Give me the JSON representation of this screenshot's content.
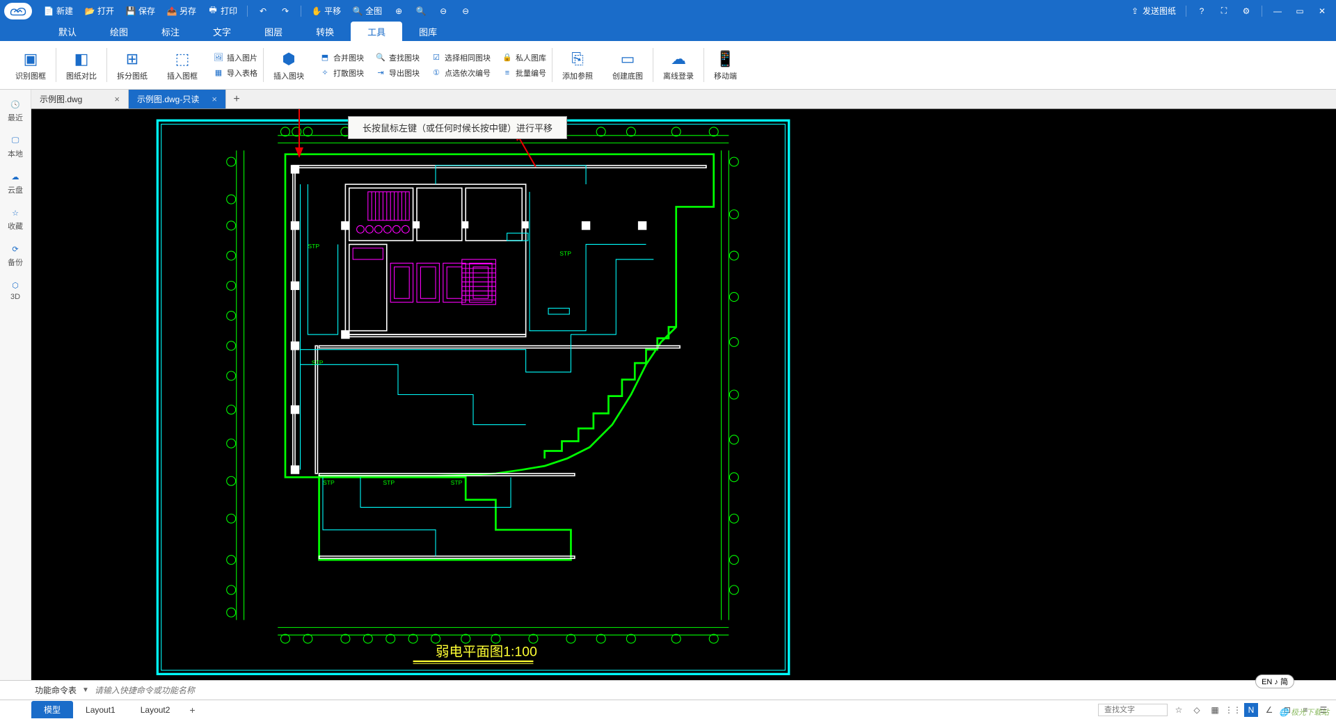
{
  "titlebar": {
    "new": "新建",
    "open": "打开",
    "save": "保存",
    "saveas": "另存",
    "print": "打印",
    "pan": "平移",
    "full": "全图",
    "send": "发送图纸"
  },
  "menu": {
    "default": "默认",
    "draw": "绘图",
    "annotate": "标注",
    "text": "文字",
    "layer": "图层",
    "convert": "转换",
    "tools": "工具",
    "library": "图库"
  },
  "ribbon": {
    "recognize_frame": "识别图框",
    "compare": "图纸对比",
    "split": "拆分图纸",
    "insert_frame": "插入图框",
    "insert_image": "插入图片",
    "import_table": "导入表格",
    "insert_block": "插入图块",
    "merge_block": "合并图块",
    "explode_block": "打散图块",
    "find_block": "查找图块",
    "export_block": "导出图块",
    "select_same": "选择相同图块",
    "click_number": "点选依次编号",
    "private_lib": "私人图库",
    "batch_number": "批量编号",
    "add_ref": "添加参照",
    "create_base": "创建底图",
    "offline_login": "离线登录",
    "mobile": "移动端"
  },
  "sidebar": {
    "recent": "最近",
    "local": "本地",
    "cloud": "云盘",
    "favorite": "收藏",
    "backup": "备份",
    "three_d": "3D"
  },
  "tabs": {
    "tab1": "示例图.dwg",
    "tab2": "示例图.dwg-只读"
  },
  "tooltip": "长按鼠标左键（或任何时候长按中键）进行平移",
  "drawing": {
    "title": "弱电平面图",
    "scale": "1:100"
  },
  "cmdbar": {
    "label": "功能命令表",
    "placeholder": "请输入快捷命令或功能名称"
  },
  "statusbar": {
    "model": "模型",
    "layout1": "Layout1",
    "layout2": "Layout2",
    "search_placeholder": "查找文字"
  },
  "lang_pill": "EN ♪ 简",
  "watermark": "极光下载站"
}
